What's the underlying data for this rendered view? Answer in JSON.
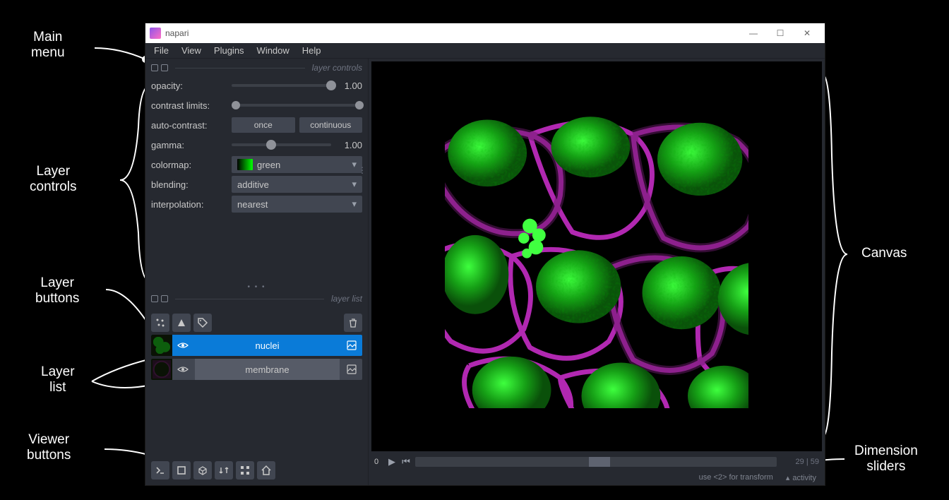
{
  "window": {
    "title": "napari"
  },
  "menu": [
    "File",
    "View",
    "Plugins",
    "Window",
    "Help"
  ],
  "panels": {
    "controls_title": "layer controls",
    "list_title": "layer list"
  },
  "controls": {
    "opacity": {
      "label": "opacity:",
      "value": "1.00",
      "pos": 100
    },
    "contrast": {
      "label": "contrast limits:",
      "low": 3,
      "high": 98
    },
    "auto": {
      "label": "auto-contrast:",
      "once": "once",
      "continuous": "continuous"
    },
    "gamma": {
      "label": "gamma:",
      "value": "1.00",
      "pos": 40
    },
    "colormap": {
      "label": "colormap:",
      "value": "green"
    },
    "blending": {
      "label": "blending:",
      "value": "additive"
    },
    "interp": {
      "label": "interpolation:",
      "value": "nearest"
    }
  },
  "layer_buttons": {
    "new_points": "new-points",
    "new_shapes": "new-shapes",
    "new_labels": "new-labels",
    "delete": "delete-layer"
  },
  "layers": [
    {
      "name": "nuclei",
      "selected": true,
      "thumb": "green"
    },
    {
      "name": "membrane",
      "selected": false,
      "thumb": "magenta"
    }
  ],
  "dims": {
    "axis": "0",
    "pos": 29,
    "max": 59,
    "readout": "29 | 59"
  },
  "status": {
    "hint": "use <2> for transform",
    "activity": "activity"
  },
  "annotations": {
    "main_menu": "Main\nmenu",
    "layer_controls": "Layer\ncontrols",
    "layer_buttons": "Layer\nbuttons",
    "layer_list": "Layer\nlist",
    "viewer_buttons": "Viewer\nbuttons",
    "canvas": "Canvas",
    "dim_sliders": "Dimension\nsliders"
  }
}
